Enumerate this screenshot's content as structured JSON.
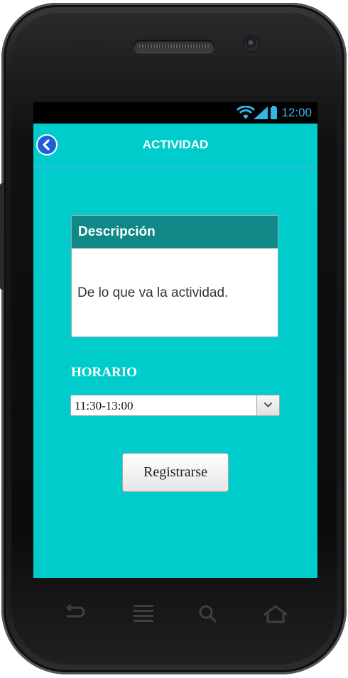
{
  "status_bar": {
    "time": "12:00"
  },
  "header": {
    "title": "ACTIVIDAD"
  },
  "description": {
    "title": "Descripción",
    "text": "De lo que va la actividad."
  },
  "schedule": {
    "label": "HORARIO",
    "selected": "11:30-13:00"
  },
  "actions": {
    "register_label": "Registrarse"
  },
  "colors": {
    "screen_bg": "#00cccc",
    "card_header": "#118888",
    "accent": "#33b5e5"
  }
}
